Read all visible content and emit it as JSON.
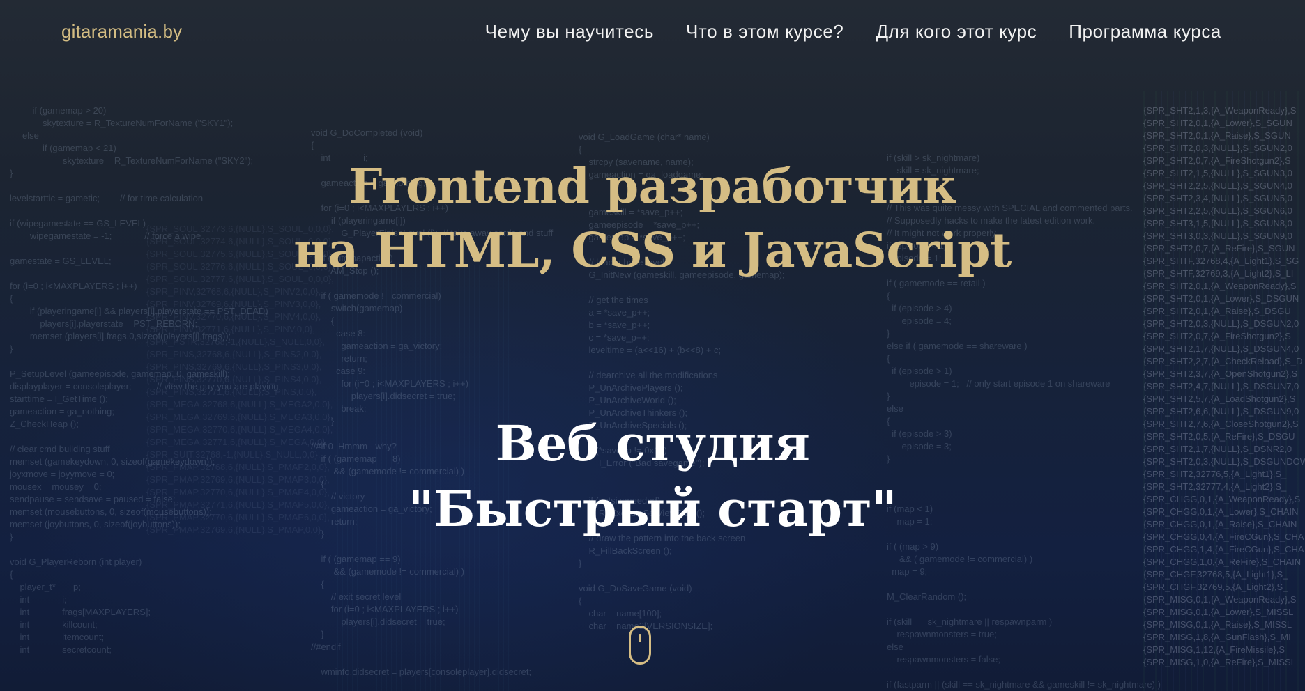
{
  "header": {
    "logo": "gitaramania.by",
    "nav": [
      {
        "label": "Чему вы научитесь"
      },
      {
        "label": "Что в этом курсе?"
      },
      {
        "label": "Для кого этот курс"
      },
      {
        "label": "Программа курса"
      }
    ]
  },
  "hero": {
    "title_line1": "Frontend разработчик",
    "title_line2": "на HTML, CSS и JavaScript",
    "subtitle_line1": "Веб студия",
    "subtitle_line2": "\"Быстрый старт\"",
    "scroll_icon": "mouse-scroll-icon"
  },
  "colors": {
    "accent": "#d5bd84",
    "nav_text": "#f2f2f2",
    "background": "#1c2431"
  }
}
